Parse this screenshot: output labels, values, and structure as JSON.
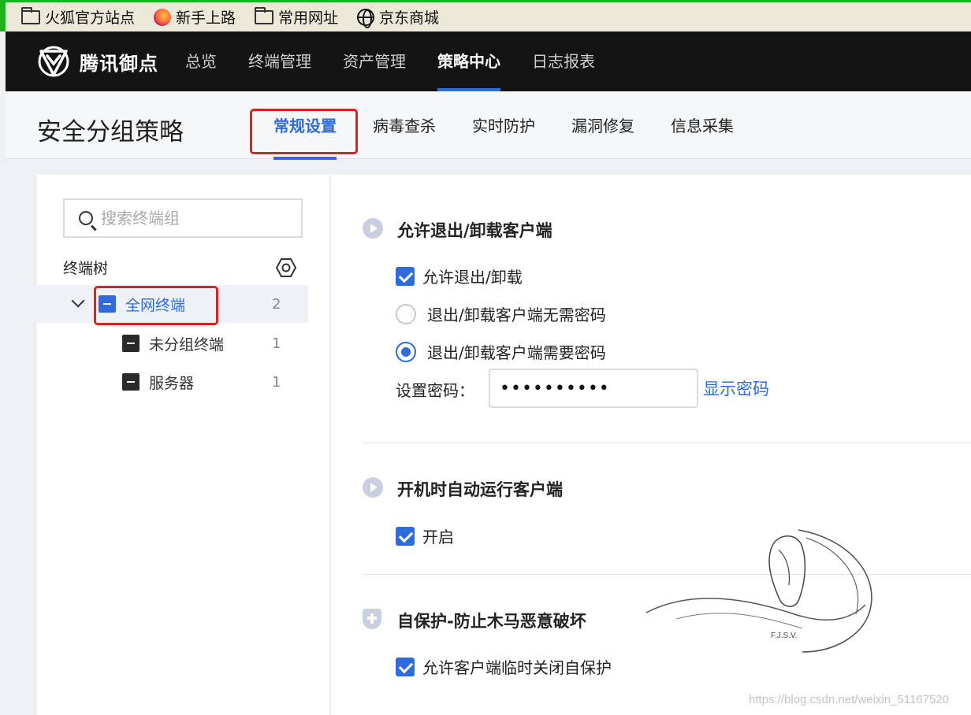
{
  "bookmarks": [
    {
      "label": "火狐官方站点",
      "icon": "folder-icon"
    },
    {
      "label": "新手上路",
      "icon": "firefox-icon"
    },
    {
      "label": "常用网址",
      "icon": "folder-icon"
    },
    {
      "label": "京东商城",
      "icon": "globe-icon"
    }
  ],
  "nav": {
    "brand": "腾讯御点",
    "items": [
      "总览",
      "终端管理",
      "资产管理",
      "策略中心",
      "日志报表"
    ],
    "active": "策略中心"
  },
  "page": {
    "title": "安全分组策略",
    "tabs": [
      "常规设置",
      "病毒查杀",
      "实时防护",
      "漏洞修复",
      "信息采集"
    ],
    "active_tab": "常规设置"
  },
  "sidebar": {
    "search_placeholder": "搜索终端组",
    "tree_label": "终端树",
    "nodes": [
      {
        "label": "全网终端",
        "count": "2",
        "selected": true
      },
      {
        "label": "未分组终端",
        "count": "1"
      },
      {
        "label": "服务器",
        "count": "1"
      }
    ]
  },
  "sections": {
    "uninstall": {
      "title": "允许退出/卸载客户端",
      "allow_label": "允许退出/卸载",
      "no_password_label": "退出/卸载客户端无需密码",
      "need_password_label": "退出/卸载客户端需要密码",
      "password_label": "设置密码：",
      "password_value": "••••••••••",
      "show_password": "显示密码"
    },
    "autostart": {
      "title": "开机时自动运行客户端",
      "enable_label": "开启"
    },
    "selfprotect": {
      "title": "自保护-防止木马恶意破坏",
      "allow_label": "允许客户端临时关闭自保护"
    }
  },
  "watermark": {
    "initials": "F.J.S.V.",
    "url": "https://blog.csdn.net/weixin_51167520"
  },
  "colors": {
    "accent": "#2f6bdc",
    "highlight": "#e02020",
    "nav_bg": "#141414"
  }
}
